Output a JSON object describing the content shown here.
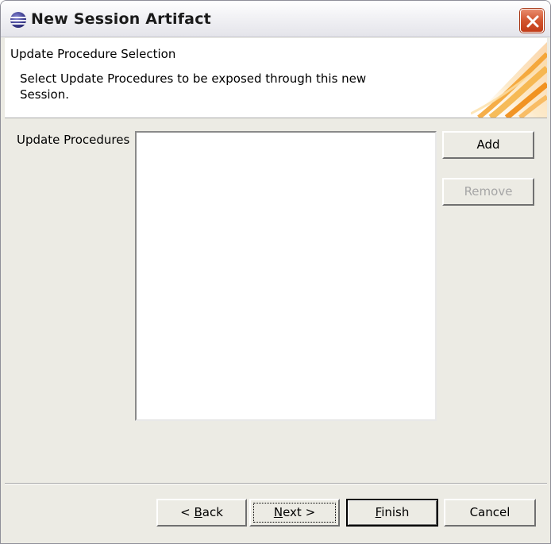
{
  "window": {
    "title": "New Session Artifact"
  },
  "header": {
    "title": "Update Procedure Selection",
    "description": "Select Update Procedures to be exposed through this new Session."
  },
  "form": {
    "list_label": "Update Procedures",
    "list_items": [],
    "add_label": "Add",
    "remove_label": "Remove"
  },
  "footer": {
    "back_prefix": "< ",
    "back_mnemonic": "B",
    "back_rest": "ack",
    "next_mnemonic": "N",
    "next_rest": "ext >",
    "finish_mnemonic": "F",
    "finish_rest": "inish",
    "cancel_label": "Cancel"
  },
  "icons": {
    "title": "eclipse-icon",
    "close": "close-icon",
    "banner": "wizard-banner-graphic"
  },
  "colors": {
    "close_button": "#d2552f",
    "banner_accent": "#f5a623",
    "dialog_bg": "#ecebe4"
  }
}
